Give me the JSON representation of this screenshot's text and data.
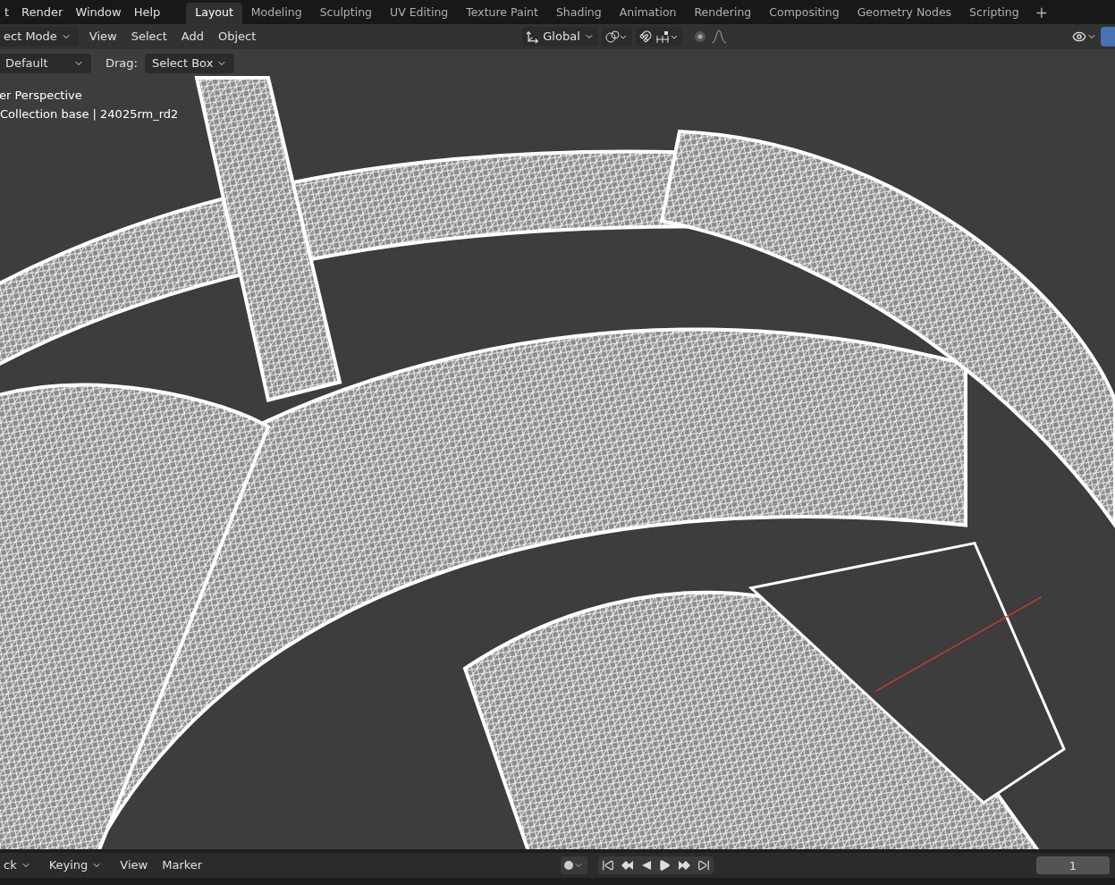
{
  "menu": [
    "t",
    "Render",
    "Window",
    "Help"
  ],
  "workspaces": [
    {
      "label": "Layout",
      "selected": true
    },
    {
      "label": "Modeling",
      "selected": false
    },
    {
      "label": "Sculpting",
      "selected": false
    },
    {
      "label": "UV Editing",
      "selected": false
    },
    {
      "label": "Texture Paint",
      "selected": false
    },
    {
      "label": "Shading",
      "selected": false
    },
    {
      "label": "Animation",
      "selected": false
    },
    {
      "label": "Rendering",
      "selected": false
    },
    {
      "label": "Compositing",
      "selected": false
    },
    {
      "label": "Geometry Nodes",
      "selected": false
    },
    {
      "label": "Scripting",
      "selected": false
    }
  ],
  "add_workspace": "+",
  "header": {
    "mode": "ect Mode",
    "menus": [
      "View",
      "Select",
      "Add",
      "Object"
    ],
    "orientation": "Global"
  },
  "tool_settings": {
    "pivot": "Default",
    "drag_label": "Drag:",
    "drag_value": "Select Box"
  },
  "viewport": {
    "view_name": "er Perspective",
    "collection": "Collection base | 24025rm_rd2"
  },
  "timeline": {
    "playback": "ck",
    "keying": "Keying",
    "menus": [
      "View",
      "Marker"
    ],
    "frame": "1"
  }
}
